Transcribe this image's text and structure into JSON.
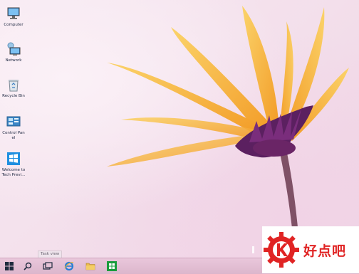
{
  "desktop_icons": [
    {
      "label": "Computer",
      "icon": "computer-icon"
    },
    {
      "label": "Network",
      "icon": "network-icon"
    },
    {
      "label": "Recycle Bin",
      "icon": "recycle-bin-icon"
    },
    {
      "label": "Control Panel",
      "icon": "control-panel-icon"
    },
    {
      "label": "Welcome to Tech Previ...",
      "icon": "windows-welcome-icon"
    }
  ],
  "taskbar": {
    "items": [
      "start-button",
      "search-button",
      "task-view-button",
      "internet-explorer-button",
      "file-explorer-button",
      "store-button"
    ],
    "tooltip": "Task view"
  },
  "watermark": {
    "text": "好点吧",
    "logo": "gear-k-logo-icon",
    "color": "#e02424"
  },
  "colors": {
    "taskbar": "#dcb6cc",
    "wallpaper": "#f3dfeb",
    "petal": "#f5a623"
  }
}
